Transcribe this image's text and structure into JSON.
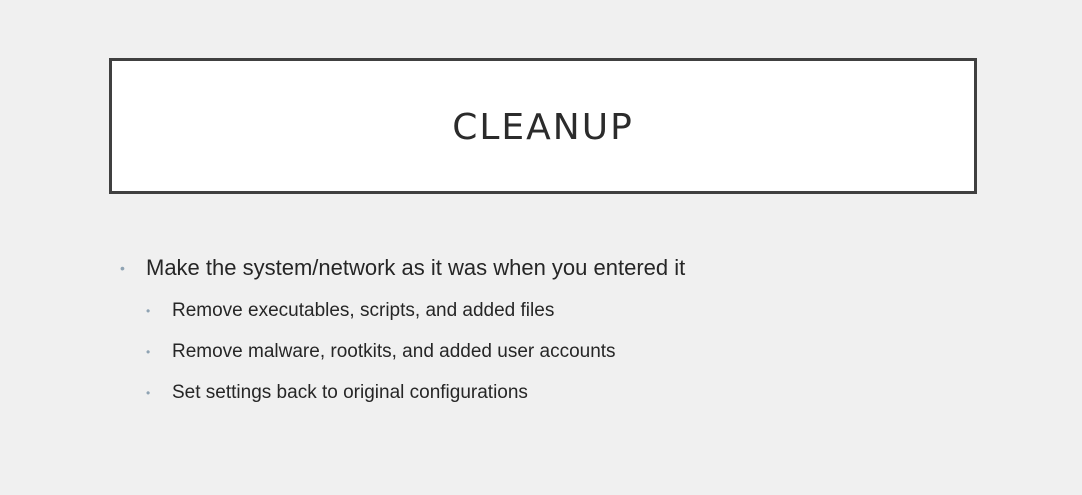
{
  "slide": {
    "title": "CLEANUP",
    "bullets": {
      "main": "Make the system/network as it was when you entered it",
      "sub": [
        "Remove executables, scripts, and added files",
        "Remove malware, rootkits, and added user accounts",
        "Set settings back to original configurations"
      ]
    },
    "bullet_glyph": "•",
    "colors": {
      "background": "#f0f0f0",
      "title_box": "#ffffff",
      "title_border": "#404040",
      "bullet": "#8fa3b3",
      "text": "#262626"
    }
  }
}
